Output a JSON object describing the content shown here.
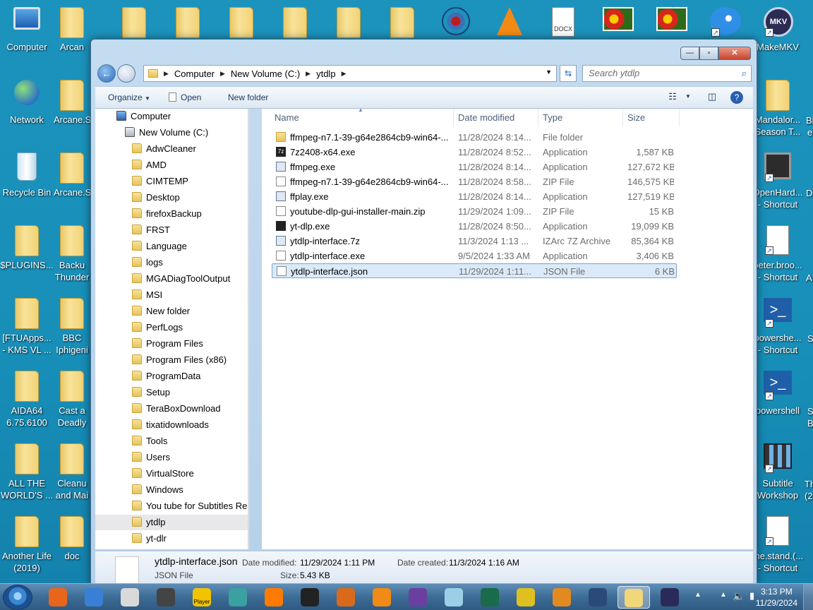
{
  "desktop": {
    "left_icons": [
      {
        "label": "Computer"
      },
      {
        "label": "Arcan"
      },
      {
        "label": "Network"
      },
      {
        "label": "Arcane.S"
      },
      {
        "label": "Recycle Bin"
      },
      {
        "label": "Arcane.S"
      },
      {
        "label": "$PLUGINS..."
      },
      {
        "label": "Backu",
        "label2": "Thunder"
      },
      {
        "label": "[FTUApps...",
        "label2": "- KMS VL ..."
      },
      {
        "label": "BBC",
        "label2": "Iphigeni"
      },
      {
        "label": "AIDA64",
        "label2": "6.75.6100"
      },
      {
        "label": "Cast a",
        "label2": "Deadly"
      },
      {
        "label": "ALL THE",
        "label2": "WORLD'S ..."
      },
      {
        "label": "Cleanu",
        "label2": "and Mai"
      },
      {
        "label": "Another Life",
        "label2": "(2019)"
      },
      {
        "label": "doc"
      }
    ],
    "right_icons": [
      {
        "label": "MakeMKV",
        "icon_text": "MKV"
      },
      {
        "label": "Mandalor...",
        "label2": "Season T..."
      },
      {
        "label": "OpenHard...",
        "label2": "- Shortcut"
      },
      {
        "label": "peter.broo...",
        "label2": "- Shortcut"
      },
      {
        "label": "powershe...",
        "label2": "- Shortcut"
      },
      {
        "label": "powershell"
      },
      {
        "label": "Subtitle",
        "label2": "Workshop"
      },
      {
        "label": "the.stand.(...",
        "label2": "- Shortcut"
      }
    ],
    "edge_fragments": [
      "Bi",
      "e",
      "D",
      "A",
      "S",
      "S",
      "B",
      "Th",
      "(2"
    ],
    "top_doc_icon_text": "DOCX"
  },
  "window": {
    "buttons": {
      "minimize": "—",
      "maximize": "▫",
      "close": "✕"
    },
    "address": {
      "crumbs": [
        "Computer",
        "New Volume (C:)",
        "ytdlp"
      ]
    },
    "search": {
      "placeholder": "Search ytdlp"
    },
    "toolbar": {
      "organize": "Organize",
      "open": "Open",
      "new_folder": "New folder"
    },
    "nav": [
      {
        "label": "Computer",
        "level": 0
      },
      {
        "label": "New Volume (C:)",
        "level": 1
      },
      {
        "label": "AdwCleaner",
        "level": 2
      },
      {
        "label": "AMD",
        "level": 2
      },
      {
        "label": "CIMTEMP",
        "level": 2
      },
      {
        "label": "Desktop",
        "level": 2
      },
      {
        "label": "firefoxBackup",
        "level": 2
      },
      {
        "label": "FRST",
        "level": 2
      },
      {
        "label": "Language",
        "level": 2
      },
      {
        "label": "logs",
        "level": 2
      },
      {
        "label": "MGADiagToolOutput",
        "level": 2
      },
      {
        "label": "MSI",
        "level": 2
      },
      {
        "label": "New folder",
        "level": 2
      },
      {
        "label": "PerfLogs",
        "level": 2
      },
      {
        "label": "Program Files",
        "level": 2
      },
      {
        "label": "Program Files (x86)",
        "level": 2
      },
      {
        "label": "ProgramData",
        "level": 2
      },
      {
        "label": "Setup",
        "level": 2
      },
      {
        "label": "TeraBoxDownload",
        "level": 2
      },
      {
        "label": "tixatidownloads",
        "level": 2
      },
      {
        "label": "Tools",
        "level": 2
      },
      {
        "label": "Users",
        "level": 2
      },
      {
        "label": "VirtualStore",
        "level": 2
      },
      {
        "label": "Windows",
        "level": 2
      },
      {
        "label": "You tube for Subtitles Re",
        "level": 2
      },
      {
        "label": "ytdlp",
        "level": 2,
        "selected": true
      },
      {
        "label": "yt-dlr",
        "level": 2
      }
    ],
    "columns": [
      "Name",
      "Date modified",
      "Type",
      "Size"
    ],
    "files": [
      {
        "name": "ffmpeg-n7.1-39-g64e2864cb9-win64-...",
        "date": "11/28/2024 8:14...",
        "type": "File folder",
        "size": "",
        "icon": "folder"
      },
      {
        "name": "7z2408-x64.exe",
        "date": "11/28/2024 8:52...",
        "type": "Application",
        "size": "1,587 KB",
        "icon": "dark",
        "icon_text": "7z"
      },
      {
        "name": "ffmpeg.exe",
        "date": "11/28/2024 8:14...",
        "type": "Application",
        "size": "127,672 KB",
        "icon": "app"
      },
      {
        "name": "ffmpeg-n7.1-39-g64e2864cb9-win64-...",
        "date": "11/28/2024 8:58...",
        "type": "ZIP File",
        "size": "146,575 KB",
        "icon": "doc"
      },
      {
        "name": "ffplay.exe",
        "date": "11/28/2024 8:14...",
        "type": "Application",
        "size": "127,519 KB",
        "icon": "app"
      },
      {
        "name": "youtube-dlp-gui-installer-main.zip",
        "date": "11/29/2024 1:09...",
        "type": "ZIP File",
        "size": "15 KB",
        "icon": "doc"
      },
      {
        "name": "yt-dlp.exe",
        "date": "11/28/2024 8:50...",
        "type": "Application",
        "size": "19,099 KB",
        "icon": "dark"
      },
      {
        "name": "ytdlp-interface.7z",
        "date": "11/3/2024 1:13 ...",
        "type": "IZArc 7Z Archive",
        "size": "85,364 KB",
        "icon": "app"
      },
      {
        "name": "ytdlp-interface.exe",
        "date": "9/5/2024 1:33 AM",
        "type": "Application",
        "size": "3,406 KB",
        "icon": "doc"
      },
      {
        "name": "ytdlp-interface.json",
        "date": "11/29/2024 1:11...",
        "type": "JSON File",
        "size": "6 KB",
        "icon": "doc",
        "selected": true
      }
    ],
    "details": {
      "filename": "ytdlp-interface.json",
      "filetype": "JSON File",
      "date_modified_label": "Date modified:",
      "date_modified": "11/29/2024 1:11 PM",
      "date_created_label": "Date created:",
      "date_created": "11/3/2024 1:16 AM",
      "size_label": "Size:",
      "size": "5.43 KB"
    }
  },
  "taskbar": {
    "apps": [
      "firefox-icon",
      "thunderbird-icon",
      "media-icon",
      "indesign-icon",
      "player-icon",
      "antenna-icon",
      "audacity-icon",
      "clapper-icon",
      "orb-icon",
      "vlc-icon",
      "cpu-icon",
      "notes-icon",
      "i-icon",
      "chart-icon",
      "cocktail-icon",
      "wifi-icon",
      "explorer-icon",
      "mkv-icon"
    ],
    "player_label": "Player",
    "clock_time": "3:13 PM",
    "clock_date": "11/29/2024"
  }
}
